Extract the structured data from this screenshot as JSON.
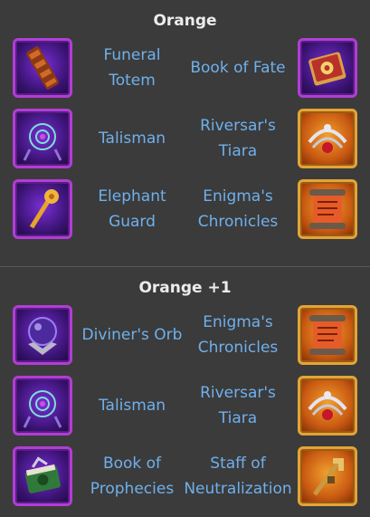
{
  "sections": [
    {
      "title": "Orange",
      "rows": [
        {
          "left": {
            "name": "Funeral\nTotem",
            "icon": "totem-icon",
            "frame": "purple"
          },
          "right": {
            "name": "Book of Fate",
            "icon": "book-icon",
            "frame": "purple"
          }
        },
        {
          "left": {
            "name": "Talisman",
            "icon": "talisman-icon",
            "frame": "purple"
          },
          "right": {
            "name": "Riversar's\nTiara",
            "icon": "tiara-icon",
            "frame": "gold"
          }
        },
        {
          "left": {
            "name": "Elephant\nGuard",
            "icon": "mace-icon",
            "frame": "purple"
          },
          "right": {
            "name": "Enigma's\nChronicles",
            "icon": "scroll-icon",
            "frame": "gold"
          }
        }
      ]
    },
    {
      "title": "Orange +1",
      "rows": [
        {
          "left": {
            "name": "Diviner's Orb",
            "icon": "orb-icon",
            "frame": "purple"
          },
          "right": {
            "name": "Enigma's\nChronicles",
            "icon": "scroll-icon",
            "frame": "gold"
          }
        },
        {
          "left": {
            "name": "Talisman",
            "icon": "talisman-icon",
            "frame": "purple"
          },
          "right": {
            "name": "Riversar's\nTiara",
            "icon": "tiara-icon",
            "frame": "gold"
          }
        },
        {
          "left": {
            "name": "Book of\nProphecies",
            "icon": "prophecy-book-icon",
            "frame": "purple"
          },
          "right": {
            "name": "Staff of\nNeutralization",
            "icon": "staff-icon",
            "frame": "gold"
          }
        }
      ]
    }
  ],
  "colors": {
    "background": "#3b3b3b",
    "title": "#ececec",
    "item_name": "#6fb0ec",
    "purple_frame": "#b03ed4",
    "gold_frame": "#e3a437"
  }
}
